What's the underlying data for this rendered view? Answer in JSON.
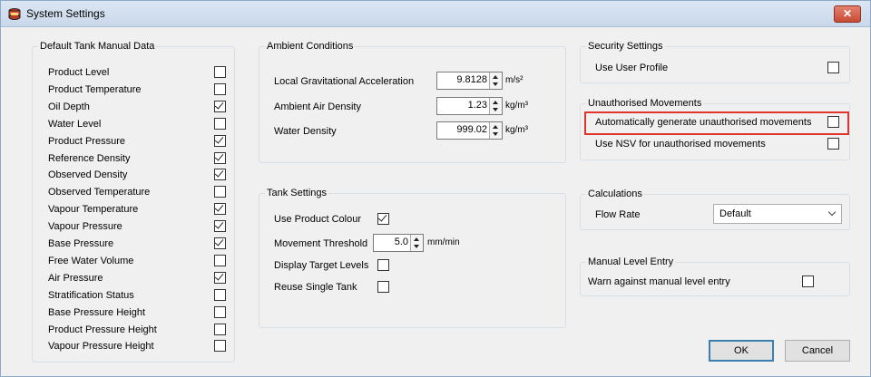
{
  "window": {
    "title": "System Settings",
    "close_label": "✕"
  },
  "tank_manual": {
    "title": "Default Tank Manual Data",
    "items": [
      {
        "label": "Product Level",
        "checked": false
      },
      {
        "label": "Product Temperature",
        "checked": false
      },
      {
        "label": "Oil Depth",
        "checked": true
      },
      {
        "label": "Water Level",
        "checked": false
      },
      {
        "label": "Product Pressure",
        "checked": true
      },
      {
        "label": "Reference Density",
        "checked": true
      },
      {
        "label": "Observed Density",
        "checked": true
      },
      {
        "label": "Observed Temperature",
        "checked": false
      },
      {
        "label": "Vapour Temperature",
        "checked": true
      },
      {
        "label": "Vapour Pressure",
        "checked": true
      },
      {
        "label": "Base Pressure",
        "checked": true
      },
      {
        "label": "Free Water Volume",
        "checked": false
      },
      {
        "label": "Air Pressure",
        "checked": true
      },
      {
        "label": "Stratification Status",
        "checked": false
      },
      {
        "label": "Base Pressure Height",
        "checked": false
      },
      {
        "label": "Product Pressure Height",
        "checked": false
      },
      {
        "label": "Vapour Pressure Height",
        "checked": false
      }
    ]
  },
  "ambient": {
    "title": "Ambient Conditions",
    "rows": [
      {
        "label": "Local Gravitational Acceleration",
        "value": "9.8128",
        "unit": "m/s²"
      },
      {
        "label": "Ambient Air Density",
        "value": "1.23",
        "unit": "kg/m³"
      },
      {
        "label": "Water Density",
        "value": "999.02",
        "unit": "kg/m³"
      }
    ]
  },
  "tank_settings": {
    "title": "Tank Settings",
    "use_product_colour": {
      "label": "Use Product Colour",
      "checked": true
    },
    "movement_threshold": {
      "label": "Movement Threshold",
      "value": "5.0",
      "unit": "mm/min"
    },
    "display_target_levels": {
      "label": "Display Target Levels",
      "checked": false
    },
    "reuse_single_tank": {
      "label": "Reuse Single Tank",
      "checked": false
    }
  },
  "security": {
    "title": "Security Settings",
    "use_user_profile": {
      "label": "Use User Profile",
      "checked": false
    }
  },
  "unauthorised": {
    "title": "Unauthorised Movements",
    "auto_generate": {
      "label": "Automatically generate unauthorised movements",
      "checked": false
    },
    "use_nsv": {
      "label": "Use NSV for unauthorised movements",
      "checked": false
    },
    "highlight_color": "#e0352c"
  },
  "calculations": {
    "title": "Calculations",
    "flow_rate_label": "Flow Rate",
    "flow_rate_value": "Default"
  },
  "manual_level": {
    "title": "Manual Level Entry",
    "warn": {
      "label": "Warn against manual level entry",
      "checked": false
    }
  },
  "buttons": {
    "ok": "OK",
    "cancel": "Cancel"
  }
}
